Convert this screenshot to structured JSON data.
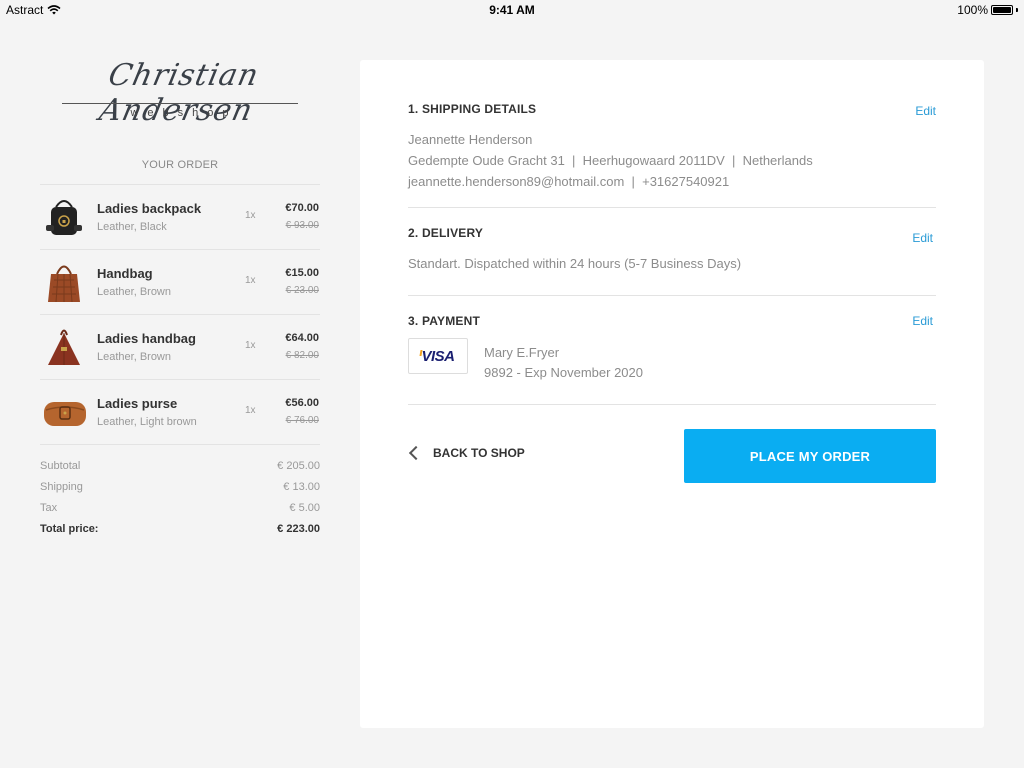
{
  "statusbar": {
    "carrier": "Astract",
    "time": "9:41 AM",
    "battery": "100%"
  },
  "brand": {
    "name": "Christian Andersen",
    "subtitle": "webshop"
  },
  "order": {
    "title": "YOUR ORDER",
    "items": [
      {
        "name": "Ladies backpack",
        "desc": "Leather, Black",
        "qty": "1x",
        "price": "€70.00",
        "old_price": "€ 93.00",
        "icon": "backpack-icon",
        "color": "#222222"
      },
      {
        "name": "Handbag",
        "desc": "Leather, Brown",
        "qty": "1x",
        "price": "€15.00",
        "old_price": "€ 23.00",
        "icon": "handbag-icon",
        "color": "#9b4a26"
      },
      {
        "name": "Ladies handbag",
        "desc": "Leather, Brown",
        "qty": "1x",
        "price": "€64.00",
        "old_price": "€ 82.00",
        "icon": "handbag-icon",
        "color": "#8a3320"
      },
      {
        "name": "Ladies purse",
        "desc": "Leather, Light brown",
        "qty": "1x",
        "price": "€56.00",
        "old_price": "€ 76.00",
        "icon": "purse-icon",
        "color": "#b5652e"
      }
    ],
    "totals": {
      "subtotal_label": "Subtotal",
      "subtotal": "€ 205.00",
      "shipping_label": "Shipping",
      "shipping": "€ 13.00",
      "tax_label": "Tax",
      "tax": "€ 5.00",
      "total_label": "Total price:",
      "total": "€ 223.00"
    }
  },
  "checkout": {
    "shipping": {
      "title": "1. SHIPPING DETAILS",
      "edit": "Edit",
      "name": "Jeannette Henderson",
      "address": "Gedempte Oude Gracht 31  |  Heerhugowaard 2011DV  |  Netherlands",
      "contact": "jeannette.henderson89@hotmail.com  |  +31627540921"
    },
    "delivery": {
      "title": "2. DELIVERY",
      "edit": "Edit",
      "text": "Standart. Dispatched within 24 hours (5-7 Business Days)"
    },
    "payment": {
      "title": "3. PAYMENT",
      "edit": "Edit",
      "card_brand": "VISA",
      "holder": "Mary E.Fryer",
      "card_info": "9892 - Exp November 2020"
    },
    "back_label": "BACK TO SHOP",
    "place_label": "PLACE MY ORDER"
  },
  "colors": {
    "accent": "#0aadf2",
    "link": "#2a9bd6",
    "background": "#f4f4f4"
  }
}
